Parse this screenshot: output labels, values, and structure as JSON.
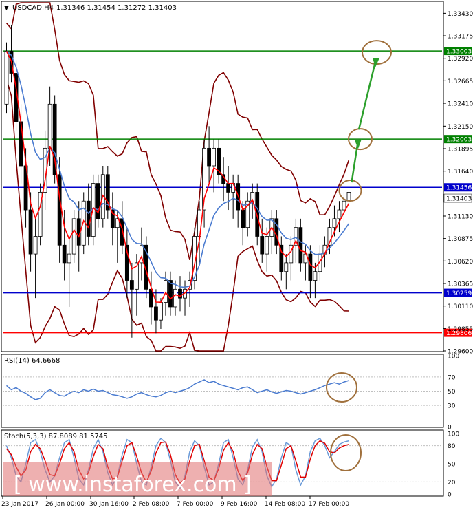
{
  "chart_data": {
    "type": "candlestick",
    "symbol_label": "USDCAD,H4",
    "ohlc_label": "1.31346 1.31454 1.31272 1.31403",
    "price_ticks": [
      "1.33430",
      "1.33175",
      "1.32920",
      "1.32665",
      "1.32410",
      "1.32150",
      "1.31895",
      "1.31640",
      "1.31130",
      "1.30875",
      "1.30620",
      "1.30365",
      "1.30110",
      "1.29855",
      "1.29600"
    ],
    "price_range": [
      1.296,
      1.3355
    ],
    "levels": [
      {
        "label": "1.33003",
        "value": 1.33003,
        "color": "#008000"
      },
      {
        "label": "1.32003",
        "value": 1.32003,
        "color": "#008000"
      },
      {
        "label": "1.31456",
        "value": 1.31456,
        "color": "#0000cc"
      },
      {
        "label": "1.30259",
        "value": 1.30259,
        "color": "#0000cc"
      },
      {
        "label": "1.29806",
        "value": 1.29806,
        "color": "#ff0000"
      }
    ],
    "current_price_label": "1.31403",
    "current_price": 1.31403,
    "date_labels": [
      "23 Jan 2017",
      "26 Jan 00:00",
      "30 Jan 16:00",
      "2 Feb 08:00",
      "7 Feb 00:00",
      "9 Feb 16:00",
      "14 Feb 08:00",
      "17 Feb 00:00"
    ],
    "candles": [
      [
        1.324,
        1.331,
        1.323,
        1.33
      ],
      [
        1.33,
        1.333,
        1.3265,
        1.3275
      ],
      [
        1.3275,
        1.329,
        1.321,
        1.322
      ],
      [
        1.322,
        1.324,
        1.315,
        1.317
      ],
      [
        1.317,
        1.319,
        1.31,
        1.312
      ],
      [
        1.312,
        1.314,
        1.305,
        1.307
      ],
      [
        1.307,
        1.311,
        1.302,
        1.309
      ],
      [
        1.309,
        1.315,
        1.308,
        1.314
      ],
      [
        1.314,
        1.321,
        1.312,
        1.319
      ],
      [
        1.319,
        1.326,
        1.317,
        1.324
      ],
      [
        1.324,
        1.325,
        1.315,
        1.316
      ],
      [
        1.316,
        1.318,
        1.306,
        1.308
      ],
      [
        1.308,
        1.312,
        1.304,
        1.306
      ],
      [
        1.306,
        1.309,
        1.301,
        1.307
      ],
      [
        1.307,
        1.312,
        1.306,
        1.311
      ],
      [
        1.311,
        1.313,
        1.305,
        1.308
      ],
      [
        1.308,
        1.314,
        1.307,
        1.313
      ],
      [
        1.313,
        1.315,
        1.308,
        1.309
      ],
      [
        1.309,
        1.316,
        1.308,
        1.315
      ],
      [
        1.315,
        1.316,
        1.31,
        1.311
      ],
      [
        1.311,
        1.317,
        1.31,
        1.316
      ],
      [
        1.316,
        1.317,
        1.311,
        1.312
      ],
      [
        1.312,
        1.314,
        1.308,
        1.31
      ],
      [
        1.31,
        1.312,
        1.306,
        1.311
      ],
      [
        1.311,
        1.313,
        1.307,
        1.308
      ],
      [
        1.308,
        1.31,
        1.302,
        1.304
      ],
      [
        1.304,
        1.306,
        1.2975,
        1.303
      ],
      [
        1.303,
        1.307,
        1.3,
        1.306
      ],
      [
        1.306,
        1.31,
        1.304,
        1.308
      ],
      [
        1.308,
        1.309,
        1.302,
        1.303
      ],
      [
        1.303,
        1.305,
        1.299,
        1.301
      ],
      [
        1.301,
        1.303,
        1.298,
        1.2995
      ],
      [
        1.2995,
        1.302,
        1.2985,
        1.3015
      ],
      [
        1.3015,
        1.305,
        1.3,
        1.304
      ],
      [
        1.304,
        1.305,
        1.3,
        1.301
      ],
      [
        1.301,
        1.304,
        1.3,
        1.303
      ],
      [
        1.303,
        1.3045,
        1.3005,
        1.302
      ],
      [
        1.302,
        1.304,
        1.3,
        1.303
      ],
      [
        1.303,
        1.305,
        1.301,
        1.304
      ],
      [
        1.304,
        1.31,
        1.303,
        1.309
      ],
      [
        1.309,
        1.313,
        1.306,
        1.312
      ],
      [
        1.312,
        1.32,
        1.31,
        1.319
      ],
      [
        1.319,
        1.3215,
        1.315,
        1.317
      ],
      [
        1.317,
        1.32,
        1.314,
        1.319
      ],
      [
        1.319,
        1.32,
        1.315,
        1.316
      ],
      [
        1.316,
        1.318,
        1.313,
        1.315
      ],
      [
        1.315,
        1.317,
        1.312,
        1.314
      ],
      [
        1.314,
        1.316,
        1.311,
        1.315
      ],
      [
        1.315,
        1.316,
        1.31,
        1.312
      ],
      [
        1.312,
        1.313,
        1.308,
        1.31
      ],
      [
        1.31,
        1.314,
        1.309,
        1.313
      ],
      [
        1.313,
        1.315,
        1.311,
        1.314
      ],
      [
        1.314,
        1.315,
        1.308,
        1.309
      ],
      [
        1.309,
        1.311,
        1.306,
        1.307
      ],
      [
        1.307,
        1.31,
        1.305,
        1.309
      ],
      [
        1.309,
        1.312,
        1.307,
        1.311
      ],
      [
        1.311,
        1.312,
        1.307,
        1.308
      ],
      [
        1.308,
        1.309,
        1.304,
        1.305
      ],
      [
        1.305,
        1.307,
        1.303,
        1.306
      ],
      [
        1.306,
        1.309,
        1.304,
        1.308
      ],
      [
        1.308,
        1.311,
        1.306,
        1.31
      ],
      [
        1.31,
        1.311,
        1.305,
        1.306
      ],
      [
        1.306,
        1.308,
        1.304,
        1.307
      ],
      [
        1.307,
        1.308,
        1.302,
        1.304
      ],
      [
        1.304,
        1.306,
        1.302,
        1.305
      ],
      [
        1.305,
        1.308,
        1.304,
        1.307
      ],
      [
        1.307,
        1.309,
        1.3055,
        1.308
      ],
      [
        1.308,
        1.311,
        1.307,
        1.31
      ],
      [
        1.31,
        1.3125,
        1.309,
        1.311
      ],
      [
        1.311,
        1.313,
        1.3095,
        1.312
      ],
      [
        1.312,
        1.314,
        1.3105,
        1.313
      ],
      [
        1.313,
        1.3146,
        1.312,
        1.314
      ]
    ]
  },
  "rsi": {
    "label": "RSI(14) 64.6668",
    "ticks": [
      "100",
      "70",
      "50",
      "30",
      "0"
    ],
    "values": [
      58,
      52,
      55,
      50,
      47,
      42,
      38,
      40,
      48,
      52,
      48,
      44,
      43,
      47,
      50,
      48,
      52,
      50,
      53,
      50,
      51,
      48,
      45,
      44,
      42,
      40,
      42,
      46,
      48,
      45,
      43,
      42,
      44,
      48,
      50,
      48,
      50,
      52,
      55,
      60,
      63,
      66,
      62,
      64,
      60,
      58,
      56,
      54,
      52,
      55,
      56,
      52,
      48,
      50,
      52,
      49,
      47,
      49,
      51,
      50,
      48,
      46,
      48,
      50,
      52,
      55,
      58,
      60,
      62,
      60,
      63,
      65
    ]
  },
  "stoch": {
    "label": "Stoch(5,3,3) 87.8089 81.5745",
    "ticks": [
      "100",
      "80",
      "50",
      "20",
      "0"
    ],
    "main": [
      80,
      60,
      30,
      20,
      50,
      85,
      90,
      70,
      40,
      20,
      30,
      60,
      85,
      90,
      60,
      25,
      15,
      40,
      75,
      90,
      70,
      35,
      15,
      30,
      65,
      90,
      85,
      50,
      20,
      15,
      45,
      80,
      92,
      85,
      55,
      20,
      10,
      30,
      70,
      88,
      80,
      45,
      15,
      20,
      50,
      85,
      90,
      60,
      25,
      15,
      40,
      78,
      90,
      70,
      30,
      12,
      25,
      60,
      85,
      80,
      40,
      15,
      30,
      70,
      88,
      92,
      80,
      60,
      70,
      82,
      86,
      88
    ],
    "signal": [
      75,
      65,
      45,
      30,
      40,
      70,
      82,
      75,
      55,
      32,
      30,
      50,
      75,
      85,
      70,
      40,
      25,
      35,
      62,
      82,
      75,
      45,
      25,
      28,
      55,
      80,
      85,
      62,
      35,
      20,
      38,
      68,
      85,
      86,
      65,
      32,
      18,
      25,
      55,
      80,
      82,
      55,
      28,
      22,
      42,
      72,
      85,
      70,
      38,
      22,
      35,
      65,
      82,
      75,
      45,
      22,
      22,
      48,
      75,
      80,
      55,
      28,
      28,
      58,
      80,
      88,
      84,
      70,
      68,
      76,
      80,
      82
    ]
  },
  "watermark": "[ www.instaforex.com ]"
}
